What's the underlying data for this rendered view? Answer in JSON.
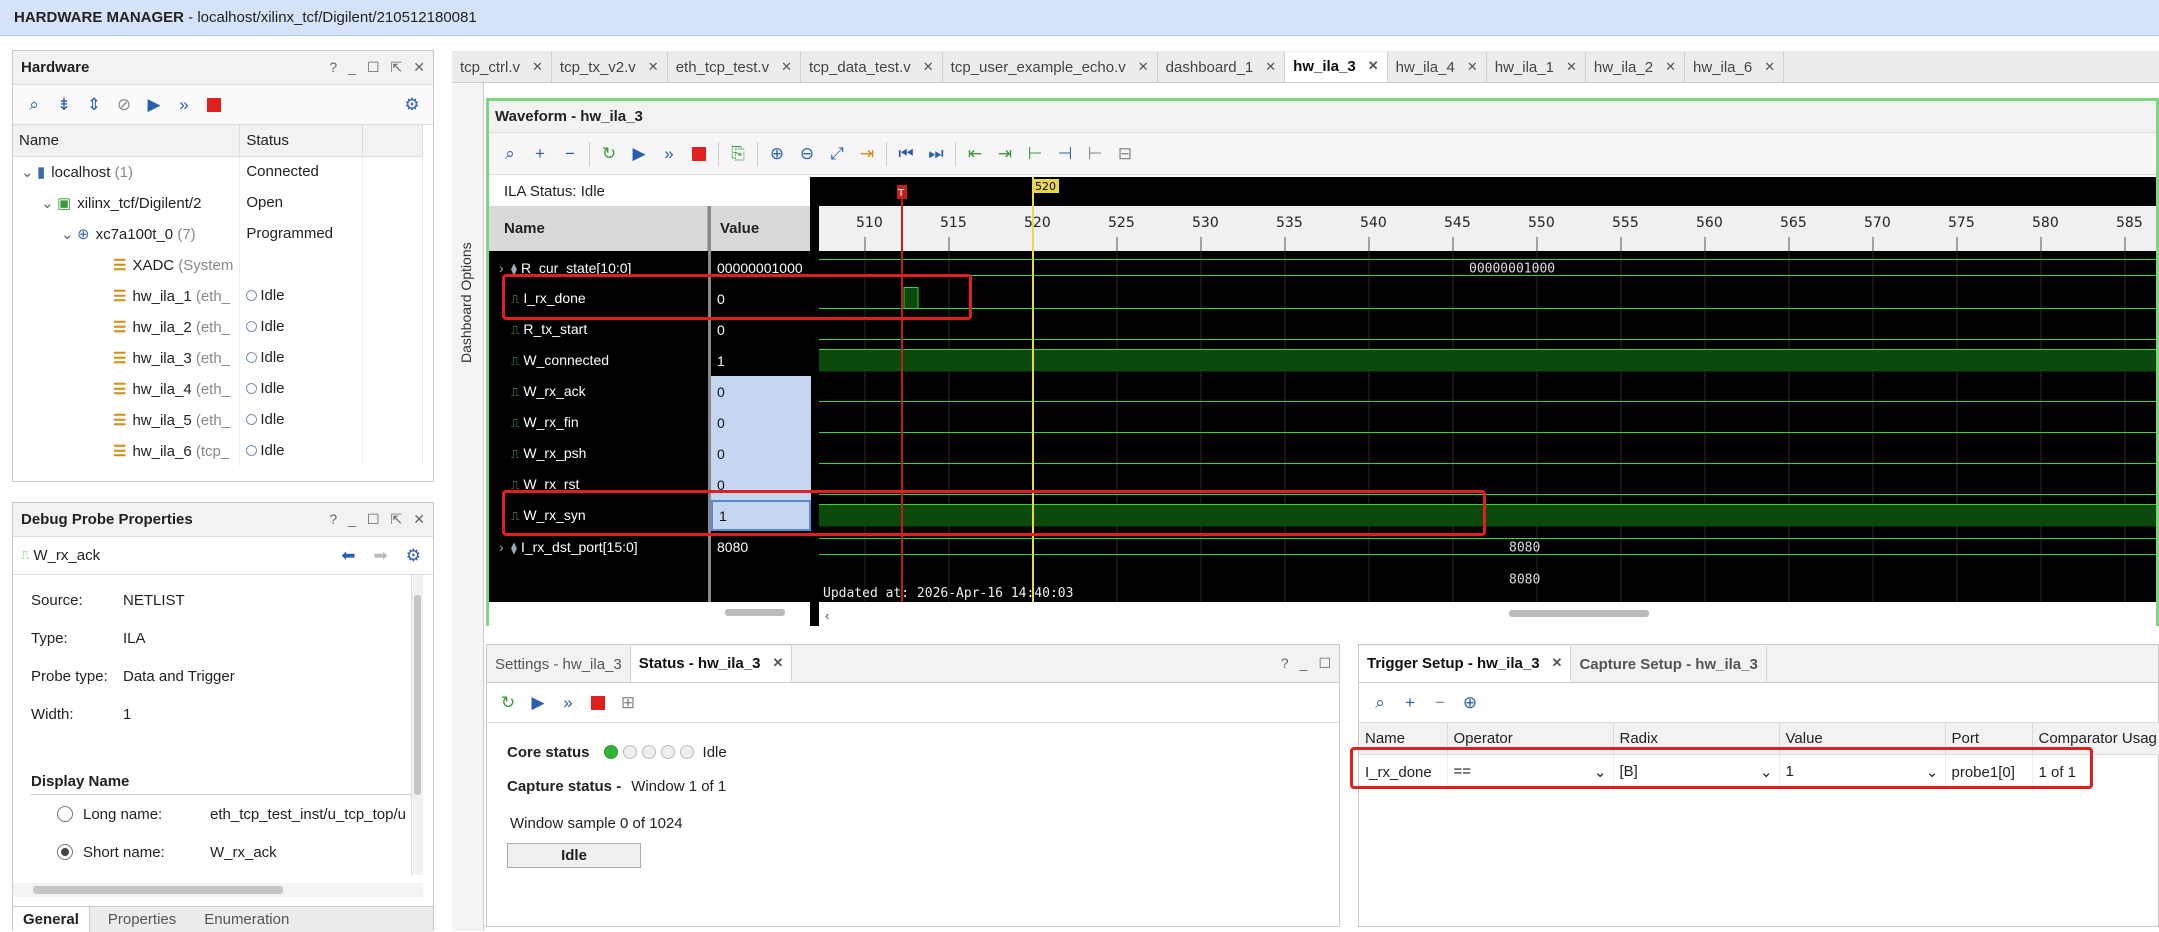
{
  "titlebar": {
    "app": "HARDWARE MANAGER",
    "path": " - localhost/xilinx_tcf/Digilent/210512180081"
  },
  "hardware": {
    "title": "Hardware",
    "columns": [
      "Name",
      "Status"
    ],
    "rows": [
      {
        "name": "localhost",
        "extra": " (1)",
        "status": "Connected",
        "icon": "host-icon"
      },
      {
        "name": "xilinx_tcf/Digilent/2",
        "extra": "",
        "status": "Open",
        "icon": "cable-icon"
      },
      {
        "name": "xc7a100t_0",
        "extra": " (7)",
        "status": "Programmed",
        "icon": "chip-icon"
      },
      {
        "name": "XADC",
        "extra": " (System",
        "status": "",
        "icon": "xadc-icon"
      },
      {
        "name": "hw_ila_1",
        "extra": " (eth_",
        "status": "Idle",
        "icon": "ila-icon"
      },
      {
        "name": "hw_ila_2",
        "extra": " (eth_",
        "status": "Idle",
        "icon": "ila-icon"
      },
      {
        "name": "hw_ila_3",
        "extra": " (eth_",
        "status": "Idle",
        "icon": "ila-icon"
      },
      {
        "name": "hw_ila_4",
        "extra": " (eth_",
        "status": "Idle",
        "icon": "ila-icon"
      },
      {
        "name": "hw_ila_5",
        "extra": " (eth_",
        "status": "Idle",
        "icon": "ila-icon"
      },
      {
        "name": "hw_ila_6",
        "extra": " (tcp_",
        "status": "Idle",
        "icon": "ila-icon"
      }
    ]
  },
  "props": {
    "title": "Debug Probe Properties",
    "probe": "W_rx_ack",
    "source_label": "Source:",
    "source": "NETLIST",
    "type_label": "Type:",
    "type": "ILA",
    "ptype_label": "Probe type:",
    "ptype": "Data and Trigger",
    "width_label": "Width:",
    "width": "1",
    "display_name": "Display Name",
    "long_label": "Long name:",
    "long_value": "eth_tcp_test_inst/u_tcp_top/u",
    "short_label": "Short name:",
    "short_value": "W_rx_ack",
    "tabs": [
      "General",
      "Properties",
      "Enumeration"
    ]
  },
  "editor_tabs": [
    "tcp_ctrl.v",
    "tcp_tx_v2.v",
    "eth_tcp_test.v",
    "tcp_data_test.v",
    "tcp_user_example_echo.v",
    "dashboard_1",
    "hw_ila_3",
    "hw_ila_4",
    "hw_ila_1",
    "hw_ila_2",
    "hw_ila_6"
  ],
  "dashboard_options": "Dashboard Options",
  "waveform": {
    "title": "Waveform - hw_ila_3",
    "ila_status": "ILA Status: Idle",
    "col_name": "Name",
    "col_value": "Value",
    "signals": [
      {
        "name": "R_cur_state[10:0]",
        "value": "00000001000",
        "bus": true
      },
      {
        "name": "I_rx_done",
        "value": "0"
      },
      {
        "name": "R_tx_start",
        "value": "0"
      },
      {
        "name": "W_connected",
        "value": "1"
      },
      {
        "name": "W_rx_ack",
        "value": "0"
      },
      {
        "name": "W_rx_fin",
        "value": "0"
      },
      {
        "name": "W_rx_psh",
        "value": "0"
      },
      {
        "name": "W_rx_rst",
        "value": "0"
      },
      {
        "name": "W_rx_syn",
        "value": "1"
      },
      {
        "name": "I_rx_dst_port[15:0]",
        "value": "8080",
        "bus": true
      }
    ],
    "ticks": [
      "510",
      "515",
      "520",
      "525",
      "530",
      "535",
      "540",
      "545",
      "550",
      "555",
      "560",
      "565",
      "570",
      "575",
      "580",
      "585"
    ],
    "trigger_marker": "T",
    "cursor_label": "520",
    "bus_value_state": "00000001000",
    "bus_value_port": "8080",
    "bus_value_port2": "8080",
    "updated": "Updated at: 2026-Apr-16 14:40:03",
    "colors": {
      "bg": "#000000",
      "signal": "#3bd03b",
      "high_fill": "#0c4a0c",
      "cursor": "#e8d84a",
      "trigger": "#c02020"
    }
  },
  "status": {
    "tabs": [
      "Settings - hw_ila_3",
      "Status - hw_ila_3"
    ],
    "core_label": "Core status",
    "core_value": "Idle",
    "capture_label": "Capture status -",
    "capture_value": "Window 1 of 1",
    "window_sample": "Window sample 0 of 1024",
    "button": "Idle"
  },
  "trigger": {
    "tabs": [
      "Trigger Setup - hw_ila_3",
      "Capture Setup - hw_ila_3"
    ],
    "columns": [
      "Name",
      "Operator",
      "Radix",
      "Value",
      "Port",
      "Comparator Usag"
    ],
    "row": {
      "name": "I_rx_done",
      "operator": "==",
      "radix": "[B]",
      "value": "1",
      "port": "probe1[0]",
      "comparator": "1 of 1"
    }
  }
}
